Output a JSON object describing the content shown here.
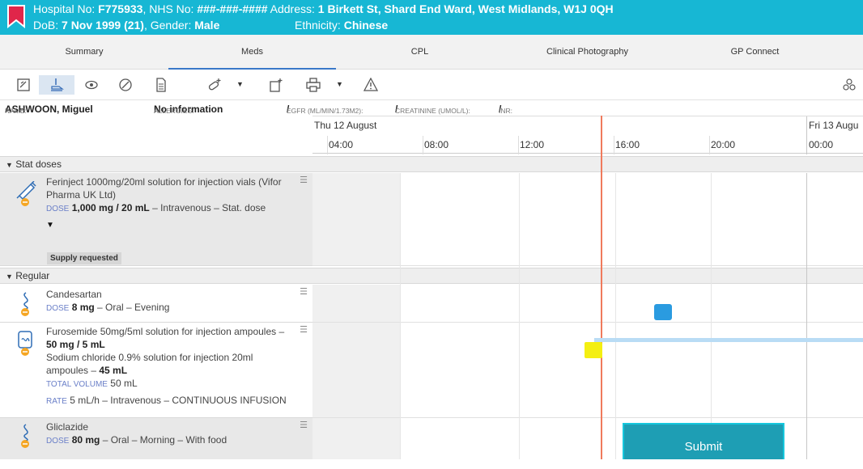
{
  "banner": {
    "hospital_label": "Hospital No: ",
    "hospital_no": "F775933",
    "nhs_label": ", NHS No: ",
    "nhs_no": "###-###-####",
    "address_label": " Address: ",
    "address": "1 Birkett St, Shard End Ward, West Midlands, W1J 0QH",
    "dob_label": "DoB: ",
    "dob": "7 Nov 1999 (21)",
    "gender_label": ", Gender: ",
    "gender": "Male",
    "ethnicity_label": "Ethnicity: ",
    "ethnicity": "Chinese"
  },
  "tabs": [
    {
      "label": "Summary"
    },
    {
      "label": "Meds"
    },
    {
      "label": "CPL"
    },
    {
      "label": "Clinical Photography"
    },
    {
      "label": "GP Connect"
    }
  ],
  "toolbar": {
    "icons": [
      "prescribe-icon",
      "administer-icon",
      "view-icon",
      "discontinue-icon",
      "document-icon",
      "add-medication-icon",
      "add-order-icon",
      "print-icon",
      "warning-icon",
      "share-icon"
    ]
  },
  "infobar": {
    "name_label": "NAME:",
    "name": "ASHWOON, Miguel",
    "allergies_label": "ALLERGIES:",
    "allergies": "No information",
    "egfr_label": "EGFR (ML/MIN/1.73M2):",
    "egfr": "/",
    "creatinine_label": "CREATININE (UMOL/L):",
    "creatinine": "/",
    "inr_label": "INR:",
    "inr": "/"
  },
  "timeline": {
    "day1": "Thu 12 August",
    "day2": "Fri 13 Augu",
    "hours": [
      "04:00",
      "08:00",
      "12:00",
      "16:00",
      "20:00",
      "00:00"
    ]
  },
  "groups": {
    "stat": "Stat doses",
    "regular": "Regular"
  },
  "meds": {
    "ferinject": {
      "name": "Ferinject 1000mg/20ml solution for injection vials (Vifor Pharma UK Ltd)",
      "dose_label": "DOSE",
      "dose": "1,000 mg / 20 mL",
      "route": " – Intravenous – Stat. dose",
      "status": "Supply requested"
    },
    "candesartan": {
      "name": "Candesartan",
      "dose_label": "DOSE",
      "dose": "8 mg",
      "route": " – Oral – Evening"
    },
    "furosemide": {
      "line1": "Furosemide 50mg/5ml solution for injection ampoules – ",
      "dose1": "50 mg / 5 mL",
      "line2": "Sodium chloride 0.9% solution for injection 20ml ampoules – ",
      "dose2": "45 mL",
      "volume_label": "TOTAL VOLUME",
      "volume": "50 mL",
      "rate_label": "RATE",
      "rate": "5 mL/h – Intravenous – CONTINUOUS INFUSION"
    },
    "gliclazide": {
      "name": "Gliclazide",
      "dose_label": "DOSE",
      "dose": "80 mg",
      "route": " – Oral – Morning – With food"
    }
  },
  "submit_label": "Submit",
  "colors": {
    "banner": "#17b7d4",
    "now_line": "#f07a5c",
    "admin_given": "#2a9be0",
    "admin_due": "#f4ef12",
    "submit": "#1e9eb4"
  }
}
